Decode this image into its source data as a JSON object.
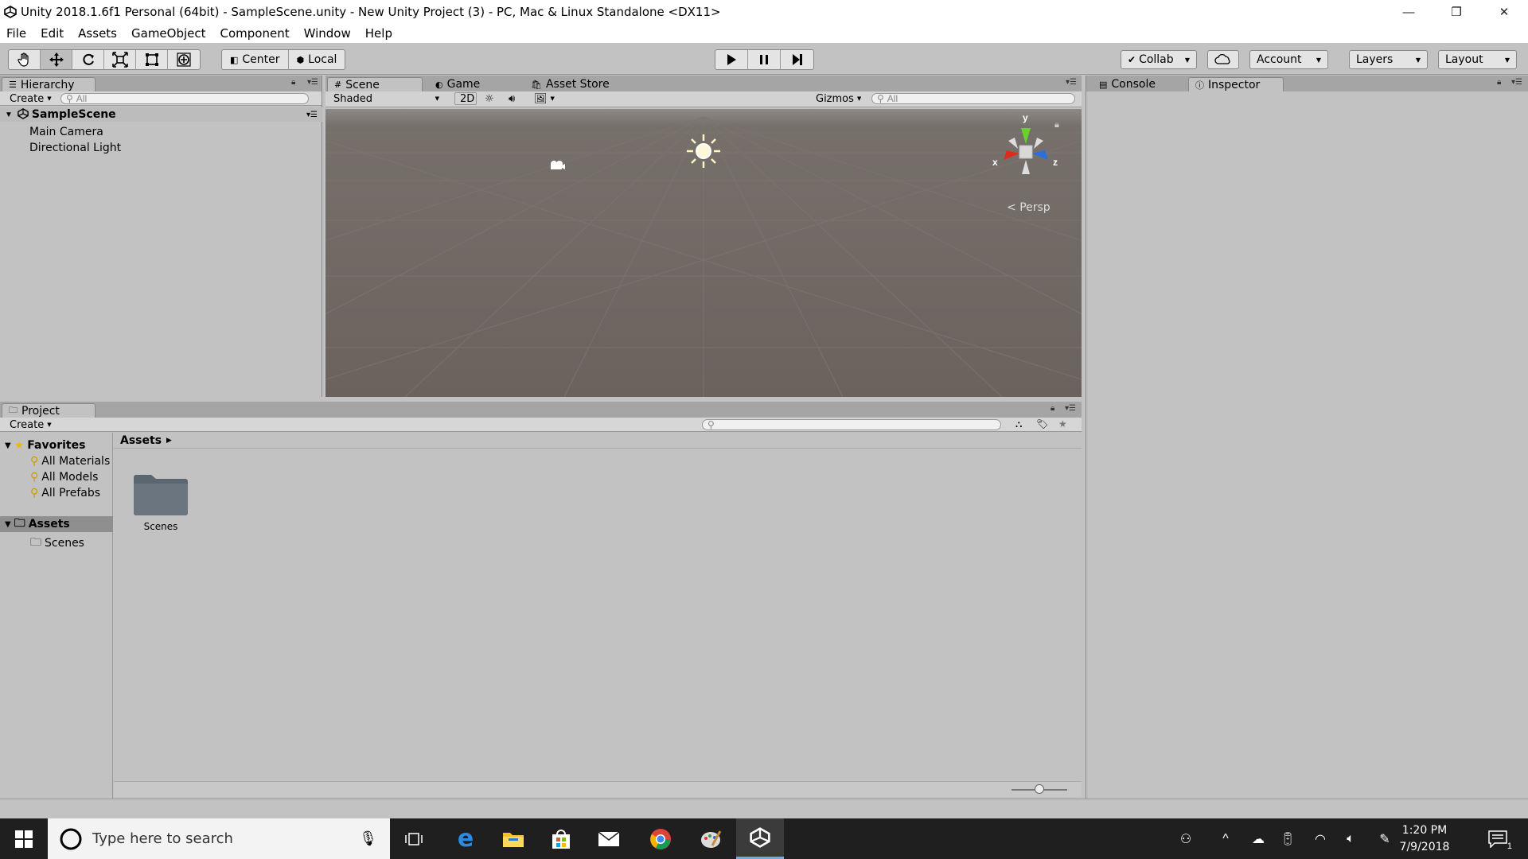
{
  "window": {
    "title": "Unity 2018.1.6f1 Personal (64bit) - SampleScene.unity - New Unity Project (3) - PC, Mac & Linux Standalone <DX11>",
    "minimize": "—",
    "restore": "❐",
    "close": "✕"
  },
  "menu": [
    "File",
    "Edit",
    "Assets",
    "GameObject",
    "Component",
    "Window",
    "Help"
  ],
  "toolbar": {
    "pivot_mode": "Center",
    "pivot_rotation": "Local",
    "collab": "Collab",
    "account": "Account",
    "layers": "Layers",
    "layout": "Layout"
  },
  "hierarchy": {
    "tab": "Hierarchy",
    "create": "Create",
    "search_placeholder": "All",
    "scene": "SampleScene",
    "items": [
      "Main Camera",
      "Directional Light"
    ]
  },
  "scene_tabs": [
    "Scene",
    "Game",
    "Asset Store"
  ],
  "scene_toolbar": {
    "shading": "Shaded",
    "mode_2d": "2D",
    "gizmos": "Gizmos",
    "search_placeholder": "All",
    "projection": "Persp",
    "axis_x": "x",
    "axis_y": "y",
    "axis_z": "z"
  },
  "inspector_tabs": [
    "Console",
    "Inspector"
  ],
  "project": {
    "tab": "Project",
    "create": "Create",
    "favorites_label": "Favorites",
    "favorites": [
      "All Materials",
      "All Models",
      "All Prefabs"
    ],
    "assets_root": "Assets",
    "asset_folders": [
      "Scenes"
    ],
    "breadcrumb": "Assets",
    "grid_items": [
      "Scenes"
    ],
    "zoom_level": 0.5
  },
  "taskbar": {
    "search_placeholder": "Type here to search",
    "time": "1:20 PM",
    "date": "7/9/2018",
    "notification_count": "1"
  }
}
